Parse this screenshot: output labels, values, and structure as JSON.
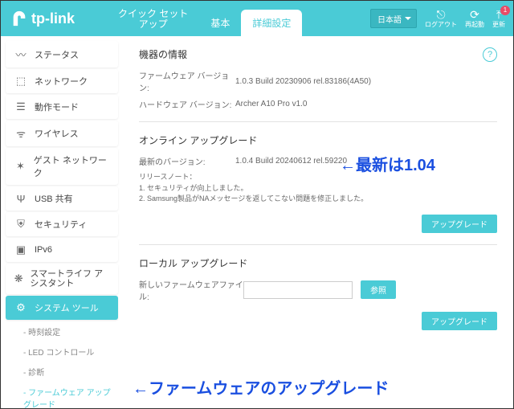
{
  "header": {
    "brand": "tp-link",
    "tabs": {
      "quick": "クイック セット\nアップ",
      "basic": "基本",
      "advanced": "詳細設定"
    },
    "language": "日本語",
    "icons": {
      "logout": "ログアウト",
      "reboot": "再起動",
      "update": "更新"
    }
  },
  "sidebar": {
    "items": [
      {
        "label": "ステータス"
      },
      {
        "label": "ネットワーク"
      },
      {
        "label": "動作モード"
      },
      {
        "label": "ワイヤレス"
      },
      {
        "label": "ゲスト ネットワーク"
      },
      {
        "label": "USB 共有"
      },
      {
        "label": "セキュリティ"
      },
      {
        "label": "IPv6"
      },
      {
        "label": "スマートライフ アシスタント"
      },
      {
        "label": "システム ツール"
      }
    ],
    "subs": [
      {
        "label": "- 時刻設定"
      },
      {
        "label": "- LED コントロール"
      },
      {
        "label": "- 診断"
      },
      {
        "label": "- ファームウェア アップグレード"
      }
    ]
  },
  "content": {
    "device_info_title": "機器の情報",
    "fw_label": "ファームウェア バージョン:",
    "fw_value": "1.0.3 Build 20230906 rel.83186(4A50)",
    "hw_label": "ハードウェア バージョン:",
    "hw_value": "Archer A10 Pro v1.0",
    "online_title": "オンライン アップグレード",
    "latest_label": "最新のバージョン:",
    "latest_value": "1.0.4 Build 20240612 rel.59220",
    "release_notes_heading": "リリースノート：",
    "release_note_1": "1. セキュリティが向上しました。",
    "release_note_2": "2. Samsung製品がNAメッセージを返してこない問題を修正しました。",
    "upgrade_btn": "アップグレード",
    "local_title": "ローカル アップグレード",
    "file_label": "新しいファームウェアファイル:",
    "browse_btn": "参照"
  },
  "annotations": {
    "a1": "←最新は1.04",
    "a2": "←ファームウェアのアップグレード"
  }
}
